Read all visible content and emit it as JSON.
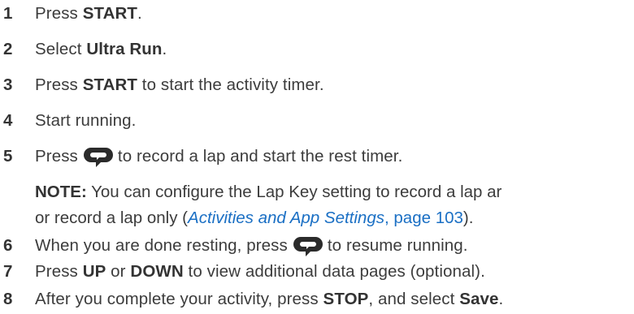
{
  "steps": [
    {
      "num": "1",
      "pre": "Press ",
      "bold": "START",
      "post": "."
    },
    {
      "num": "2",
      "pre": "Select ",
      "bold": "Ultra Run",
      "post": "."
    },
    {
      "num": "3",
      "pre": "Press ",
      "bold": "START",
      "post": " to start the activity timer."
    },
    {
      "num": "4",
      "text": "Start running."
    },
    {
      "num": "5",
      "pre": "Press",
      "icon": "lap-key-icon",
      "post": "to record a lap and start the rest timer."
    },
    {
      "num": "6",
      "pre": "When you are done resting, press",
      "icon": "lap-key-icon",
      "post": "to resume running."
    },
    {
      "num": "7",
      "pre": "Press ",
      "bold": "UP",
      "mid": " or ",
      "bold2": "DOWN",
      "post": " to view additional data pages (optional)."
    },
    {
      "num": "8",
      "pre": "After you complete your activity, press ",
      "bold": "STOP",
      "mid": ", and select ",
      "bold2": "Save",
      "post": "."
    }
  ],
  "note": {
    "label": "NOTE:",
    "line1": " You can configure the Lap Key setting to record a lap ar",
    "line2_pre": "or record a lap only (",
    "link_title": "Activities and App Settings",
    "link_sep": ", ",
    "link_page": "page 103",
    "line2_post": ")."
  },
  "colors": {
    "text": "#3c3c3c",
    "link": "#1a6fc4",
    "icon": "#2b2b2b"
  }
}
